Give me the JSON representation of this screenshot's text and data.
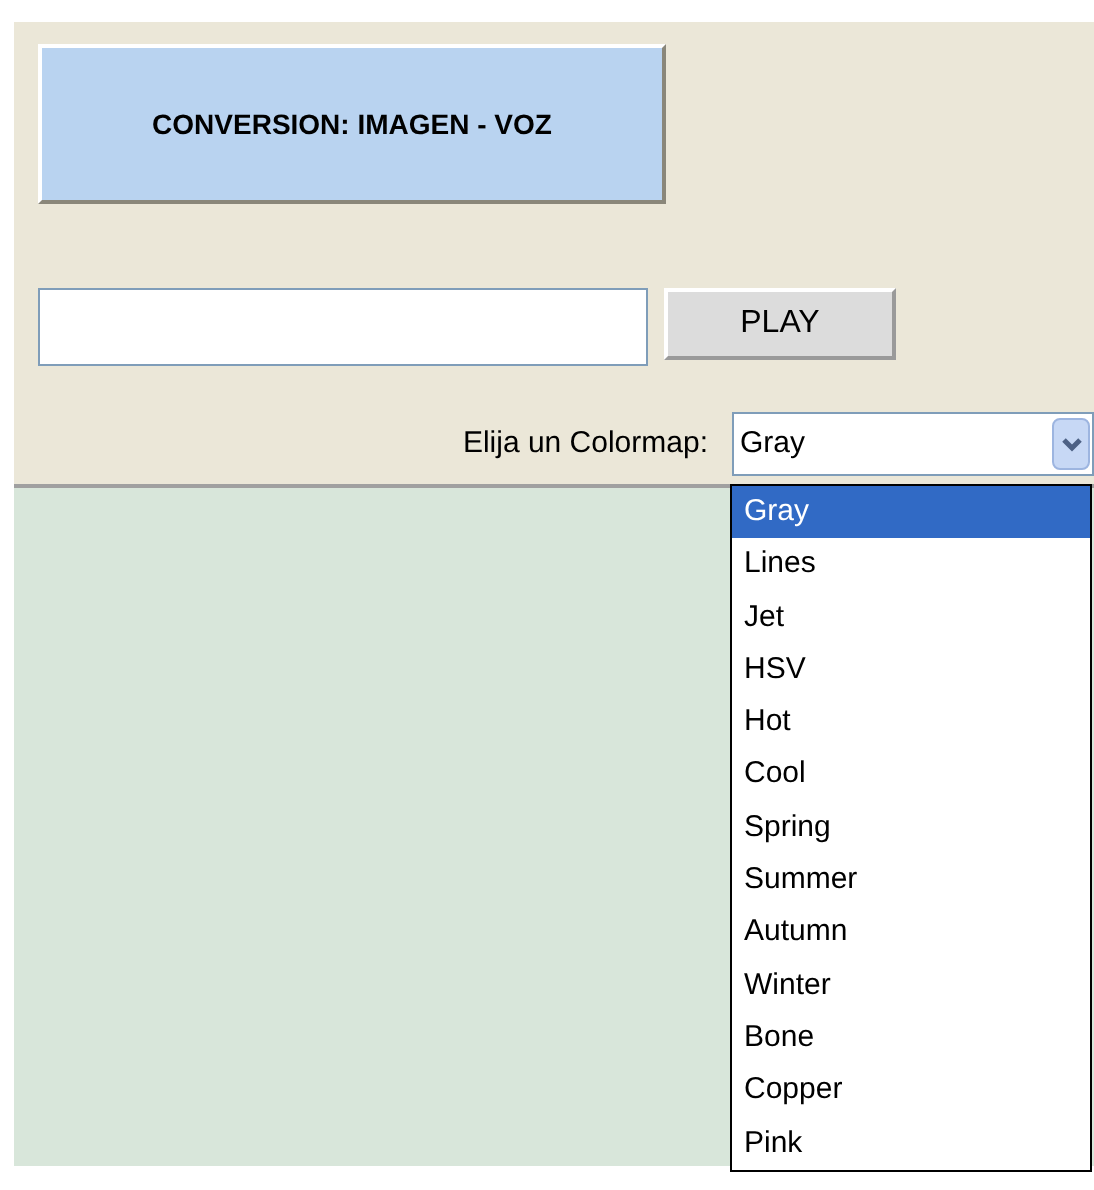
{
  "title_button": {
    "label": "CONVERSION: IMAGEN - VOZ"
  },
  "play_button": {
    "label": "PLAY"
  },
  "colormap": {
    "label": "Elija un Colormap:",
    "value": "Gray",
    "expanded": true,
    "options": [
      {
        "label": "Gray",
        "selected": true
      },
      {
        "label": "Lines",
        "selected": false
      },
      {
        "label": "Jet",
        "selected": false
      },
      {
        "label": "HSV",
        "selected": false
      },
      {
        "label": "Hot",
        "selected": false
      },
      {
        "label": "Cool",
        "selected": false
      },
      {
        "label": "Spring",
        "selected": false
      },
      {
        "label": "Summer",
        "selected": false
      },
      {
        "label": "Autumn",
        "selected": false
      },
      {
        "label": "Winter",
        "selected": false
      },
      {
        "label": "Bone",
        "selected": false
      },
      {
        "label": "Copper",
        "selected": false
      },
      {
        "label": "Pink",
        "selected": false
      }
    ]
  }
}
